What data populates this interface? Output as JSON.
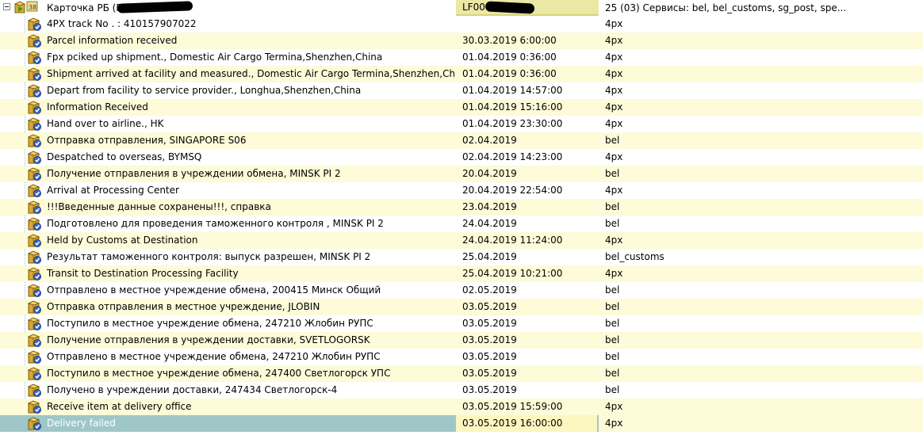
{
  "group": {
    "title": "Карточка РБ (Ростов-na...",
    "track": "LF00 .... 95SG",
    "services": "25 (03) Сервисы: bel, bel_customs, sg_post, spe..."
  },
  "colors": {
    "row_alt": "#fdfbd8",
    "row_selected": "#9fc7c8",
    "group_track_bg": "#ebe8a5"
  },
  "icons": {
    "row": "package-check-icon",
    "group": "package-group-icon",
    "expander": "collapse-minus-icon"
  },
  "rows": [
    {
      "desc": "4PX track No . : 410157907022",
      "date": "",
      "service": "4px"
    },
    {
      "desc": "Parcel information received",
      "date": "30.03.2019 6:00:00",
      "service": "4px"
    },
    {
      "desc": " Fpx pciked up shipment., Domestic Air Cargo Termina,Shenzhen,China",
      "date": "01.04.2019 0:36:00",
      "service": "4px"
    },
    {
      "desc": " Shipment arrived at facility and measured., Domestic Air Cargo Termina,Shenzhen,Chi...",
      "date": "01.04.2019 0:36:00",
      "service": "4px"
    },
    {
      "desc": " Depart from facility to service provider., Longhua,Shenzhen,China",
      "date": "01.04.2019 14:57:00",
      "service": "4px"
    },
    {
      "desc": "Information Received",
      "date": "01.04.2019 15:16:00",
      "service": "4px"
    },
    {
      "desc": " Hand over to airline., HK",
      "date": "01.04.2019 23:30:00",
      "service": "4px"
    },
    {
      "desc": "Отправка отправления, SINGAPORE S06",
      "date": "02.04.2019",
      "service": "bel"
    },
    {
      "desc": " Despatched  to overseas, BYMSQ",
      "date": "02.04.2019 14:23:00",
      "service": "4px"
    },
    {
      "desc": "Получение отправления в учреждении обмена, MINSK PI 2",
      "date": "20.04.2019",
      "service": "bel"
    },
    {
      "desc": "Arrival at Processing Center",
      "date": "20.04.2019 22:54:00",
      "service": "4px"
    },
    {
      "desc": "!!!Введенные данные сохранены!!!, справка",
      "date": "23.04.2019",
      "service": "bel"
    },
    {
      "desc": "Подготовлено для проведения таможенного контроля , MINSK PI 2",
      "date": "24.04.2019",
      "service": "bel"
    },
    {
      "desc": "Held by Customs at Destination",
      "date": "24.04.2019 11:24:00",
      "service": "4px"
    },
    {
      "desc": "Результат таможенного контроля: выпуск разрешен, MINSK PI 2",
      "date": "25.04.2019",
      "service": "bel_customs"
    },
    {
      "desc": "Transit to Destination Processing Facility",
      "date": "25.04.2019 10:21:00",
      "service": "4px"
    },
    {
      "desc": "Отправлено в местное учреждение обмена, 200415 Минск Общий",
      "date": "02.05.2019",
      "service": "bel"
    },
    {
      "desc": "Отправка отправления в местное учреждение, JLOBIN",
      "date": "03.05.2019",
      "service": "bel"
    },
    {
      "desc": "Поступило в местное учреждение обмена, 247210 Жлобин РУПС",
      "date": "03.05.2019",
      "service": "bel"
    },
    {
      "desc": "Получение отправления в учреждении доставки, SVETLOGORSK",
      "date": "03.05.2019",
      "service": "bel"
    },
    {
      "desc": "Отправлено в местное учреждение обмена, 247210 Жлобин РУПС",
      "date": "03.05.2019",
      "service": "bel"
    },
    {
      "desc": "Поступило в местное учреждение обмена, 247400 Светлогорск УПС",
      "date": "03.05.2019",
      "service": "bel"
    },
    {
      "desc": "Получено в учреждении доставки, 247434 Светлогорск-4",
      "date": "03.05.2019",
      "service": "bel"
    },
    {
      "desc": "Receive item at delivery office",
      "date": "03.05.2019 15:59:00",
      "service": "4px"
    },
    {
      "desc": "Delivery failed",
      "date": "03.05.2019 16:00:00",
      "service": "4px",
      "selected": true
    }
  ]
}
